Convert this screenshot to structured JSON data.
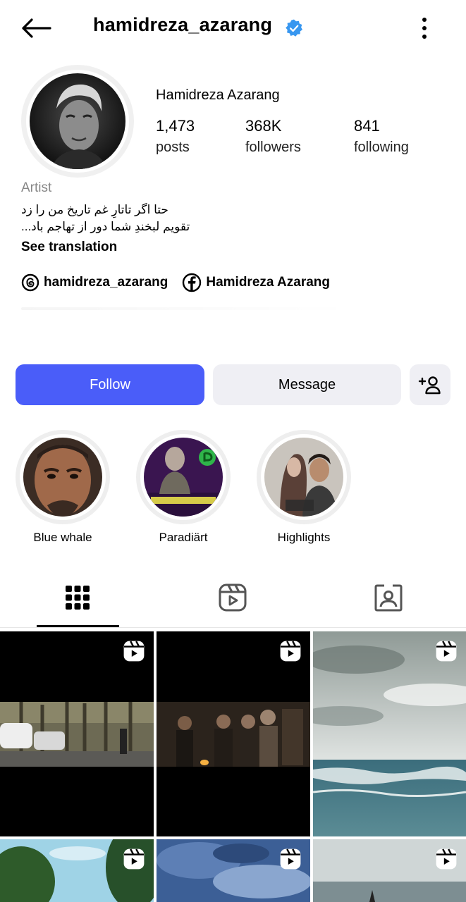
{
  "header": {
    "username": "hamidreza_azarang",
    "verified": true
  },
  "profile": {
    "full_name": "Hamidreza Azarang",
    "stats": [
      {
        "count": "1,473",
        "label": "posts"
      },
      {
        "count": "368K",
        "label": "followers"
      },
      {
        "count": "841",
        "label": "following"
      }
    ],
    "category": "Artist",
    "bio_lines": [
      "حتا اگر تاتارِ غم تاریخ من را زد",
      "تقویم لبخندِ شما دور از تهاجم باد..."
    ],
    "see_translation": "See translation",
    "links": [
      {
        "icon": "threads-icon",
        "label": "hamidreza_azarang"
      },
      {
        "icon": "facebook-icon",
        "label": "Hamidreza Azarang"
      }
    ]
  },
  "actions": {
    "follow": "Follow",
    "message": "Message",
    "add_user_icon": "add-person-icon"
  },
  "highlights": [
    {
      "label": "Blue whale"
    },
    {
      "label": "Paradiärt"
    },
    {
      "label": "Highlights"
    }
  ],
  "tabs": [
    {
      "icon": "grid-icon",
      "selected": true
    },
    {
      "icon": "reels-icon",
      "selected": false
    },
    {
      "icon": "tagged-icon",
      "selected": false
    }
  ],
  "colors": {
    "accent": "#4a5df9",
    "verified": "#3897f0",
    "secondary_button": "#efeff4"
  }
}
